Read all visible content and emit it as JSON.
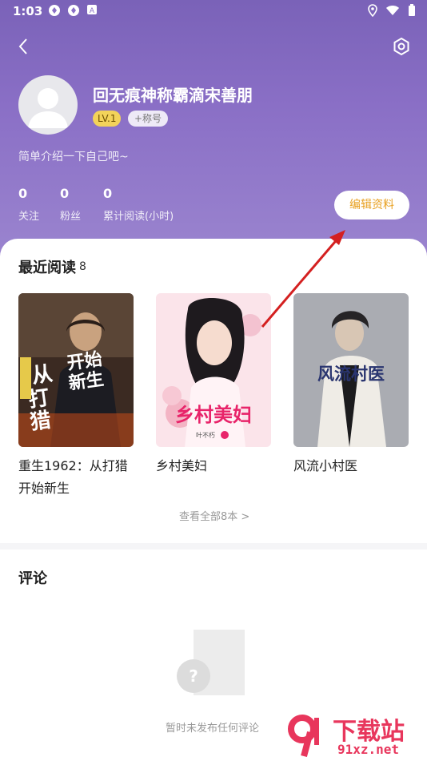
{
  "status_bar": {
    "time": "1:03"
  },
  "profile": {
    "username": "回无痕神称霸滴宋善朋",
    "level": "LV.1",
    "title_badge": "+称号",
    "bio": "简单介绍一下自己吧~",
    "stats": [
      {
        "value": "0",
        "label": "关注"
      },
      {
        "value": "0",
        "label": "粉丝"
      },
      {
        "value": "0",
        "label": "累计阅读(小时)"
      }
    ],
    "edit_button": "编辑资料"
  },
  "recent": {
    "title": "最近阅读",
    "count": "8",
    "books": [
      {
        "title": "重生1962：从打猎开始新生",
        "cover_text": "从打猎开始新生"
      },
      {
        "title": "乡村美妇",
        "cover_text": "乡村美妇"
      },
      {
        "title": "风流小村医",
        "cover_text": "风流村医"
      }
    ],
    "view_all": "查看全部8本 >"
  },
  "comments": {
    "title": "评论",
    "empty_text": "暂时未发布任何评论"
  },
  "watermark": {
    "text": "下载站",
    "url_text": "91xz.net"
  },
  "colors": {
    "header": "#8a6fc6",
    "accent": "#e8a020",
    "arrow": "#d42020"
  }
}
